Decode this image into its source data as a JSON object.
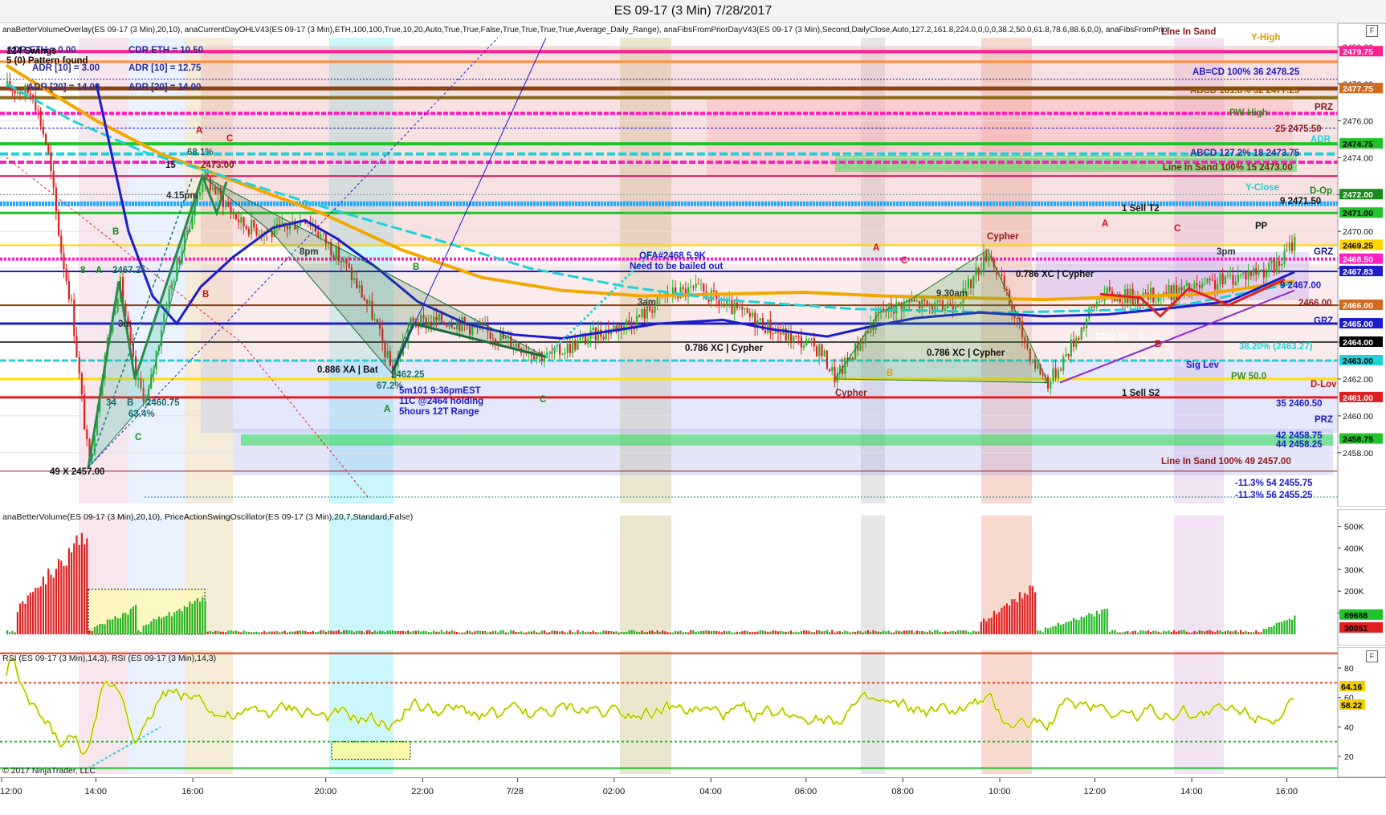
{
  "window_title": "ES 09-17 (3 Min)  7/28/2017",
  "copyright": "© 2017 NinjaTrader, LLC",
  "panel_format_icon": "F",
  "colors": {
    "up": "#26b526",
    "down": "#e02020",
    "swing": "#1c1ccc",
    "maline": "#f2a800",
    "cyan": "#1fd1d8",
    "magenta": "#ff1fbf",
    "rsi_line": "#9aa000",
    "rsi_fill": "#f0ff70"
  },
  "chart_data": [
    {
      "type": "line",
      "title": "ES 09-17 (3 Min)  7/28/2017",
      "indicator_text": "anaBetterVolumeOverlay(ES 09-17 (3 Min),20,10), anaCurrentDayOHLV43(ES 09-17 (3 Min),ETH,100,100,True,10,20,Auto,True,True,False,True,True,True,True,Average_Daily_Range), anaFibsFromPriorDayV43(ES 09-17 (3 Min),Second,DailyClose,Auto,127.2,161.8,224.0,0,0,0,38.2,50.0,61.8,78.6,88.6,0,0), anaFibsFromPrior",
      "ylim": [
        2455.25,
        2480.5
      ],
      "y_ticks": [
        2458.0,
        2460.0,
        2462.0,
        2464.0,
        2466.0,
        2468.0,
        2470.0,
        2472.0,
        2474.0,
        2476.0,
        2478.0,
        2480.0
      ],
      "y_tick_labels": [
        "2458.00",
        "2460.00",
        "2462.00",
        "2464.00",
        "2466.00",
        "2468.00",
        "2470.00",
        "2472.00",
        "2474.00",
        "2476.00",
        "2478.00",
        "2480.00"
      ],
      "price_badges": [
        {
          "value": 2479.75,
          "label": "2479.75",
          "color": "#ff1f8f"
        },
        {
          "value": 2477.75,
          "label": "2477.75",
          "color": "#d2691e"
        },
        {
          "value": 2474.75,
          "label": "2474.75",
          "color": "#22c22c"
        },
        {
          "value": 2472.0,
          "label": "2472.00",
          "color": "#1a8a1a"
        },
        {
          "value": 2471.0,
          "label": "2471.00",
          "color": "#22c22c"
        },
        {
          "value": 2469.25,
          "label": "2469.25",
          "color": "#ffd700"
        },
        {
          "value": 2468.5,
          "label": "2468.50",
          "color": "#ff1fbf"
        },
        {
          "value": 2467.83,
          "label": "2467.83",
          "color": "#1c1ccc"
        },
        {
          "value": 2466.0,
          "label": "2466.00",
          "color": "#d2691e"
        },
        {
          "value": 2465.0,
          "label": "2465.00",
          "color": "#1c1ccc"
        },
        {
          "value": 2464.0,
          "label": "2464.00",
          "color": "#000000"
        },
        {
          "value": 2463.0,
          "label": "2463.00",
          "color": "#1fd1d8"
        },
        {
          "value": 2461.0,
          "label": "2461.00",
          "color": "#e02020"
        },
        {
          "value": 2458.75,
          "label": "2458.75",
          "color": "#22c22c"
        }
      ],
      "overlay_text": [
        {
          "text": "ADR ETH = 0.00",
          "x": 8,
          "y": 66,
          "color": "#2b2b9a"
        },
        {
          "text": "CDR ETH = 10.50",
          "x": 160,
          "y": 66,
          "color": "#2b2b9a"
        },
        {
          "text": "ADR [10] = 3.00",
          "x": 40,
          "y": 88,
          "color": "#2b2b9a"
        },
        {
          "text": "ADR [10] = 12.75",
          "x": 160,
          "y": 88,
          "color": "#2b2b9a"
        },
        {
          "text": "ADR [20] = 14.00",
          "x": 34,
          "y": 112,
          "color": "#2b2b9a"
        },
        {
          "text": "ADR [20] = 14.00",
          "x": 160,
          "y": 112,
          "color": "#2b2b9a"
        },
        {
          "text": "124 Swings",
          "x": 8,
          "y": 67,
          "color": "#111111"
        },
        {
          "text": "5 (0) Pattern found",
          "x": 8,
          "y": 79,
          "color": "#111111"
        },
        {
          "text": "A",
          "x": 244,
          "y": 166,
          "color": "#d01010"
        },
        {
          "text": "C",
          "x": 282,
          "y": 176,
          "color": "#d01010"
        },
        {
          "text": "68.1%",
          "x": 233,
          "y": 193,
          "color": "#1a6a6a"
        },
        {
          "text": "15",
          "x": 206,
          "y": 209,
          "color": "#111111"
        },
        {
          "text": "2473.00",
          "x": 250,
          "y": 209,
          "color": "#8b1a1a"
        },
        {
          "text": "4.15pm",
          "x": 207,
          "y": 247,
          "color": "#333333"
        },
        {
          "text": "B",
          "x": 140,
          "y": 292,
          "color": "#1a8a1a"
        },
        {
          "text": "8",
          "x": 100,
          "y": 340,
          "color": "#1a8a1a"
        },
        {
          "text": "A",
          "x": 119,
          "y": 340,
          "color": "#1a8a1a"
        },
        {
          "text": "2467.25",
          "x": 140,
          "y": 340,
          "color": "#1a6a6a"
        },
        {
          "text": "B",
          "x": 252,
          "y": 370,
          "color": "#d01010"
        },
        {
          "text": "3m",
          "x": 147,
          "y": 407,
          "color": "#333333"
        },
        {
          "text": "34",
          "x": 132,
          "y": 505,
          "color": "#1a6a6a"
        },
        {
          "text": "B",
          "x": 158,
          "y": 505,
          "color": "#1a6a6a"
        },
        {
          "text": "2460.75",
          "x": 182,
          "y": 505,
          "color": "#1a6a6a"
        },
        {
          "text": "63.4%",
          "x": 160,
          "y": 519,
          "color": "#1a6a6a"
        },
        {
          "text": "C",
          "x": 168,
          "y": 548,
          "color": "#1a8a1a"
        },
        {
          "text": "49  X  2457.00",
          "x": 62,
          "y": 591,
          "color": "#111111"
        },
        {
          "text": "8pm",
          "x": 373,
          "y": 317,
          "color": "#333333"
        },
        {
          "text": "B",
          "x": 514,
          "y": 336,
          "color": "#1a8a1a"
        },
        {
          "text": "0.886 XA | Bat",
          "x": 395,
          "y": 464,
          "color": "#111111"
        },
        {
          "text": "2462.25",
          "x": 487,
          "y": 470,
          "color": "#1a6a6a"
        },
        {
          "text": "67.2%",
          "x": 469,
          "y": 484,
          "color": "#1a6a6a"
        },
        {
          "text": "5m101 9:36pmEST",
          "x": 497,
          "y": 490,
          "color": "#1c1ccc"
        },
        {
          "text": "11C @2464 holding",
          "x": 497,
          "y": 503,
          "color": "#1c1ccc"
        },
        {
          "text": "5hours 12T Range",
          "x": 497,
          "y": 516,
          "color": "#1c1ccc"
        },
        {
          "text": "A",
          "x": 478,
          "y": 513,
          "color": "#1a8a1a"
        },
        {
          "text": "C",
          "x": 672,
          "y": 501,
          "color": "#1a8a1a"
        },
        {
          "text": "OFA#2468 5.9K",
          "x": 796,
          "y": 322,
          "color": "#1c1ccc"
        },
        {
          "text": "Need to be bailed out",
          "x": 784,
          "y": 335,
          "color": "#1c1ccc"
        },
        {
          "text": "3am",
          "x": 794,
          "y": 380,
          "color": "#333333"
        },
        {
          "text": "0.786 XC | Cypher",
          "x": 853,
          "y": 437,
          "color": "#111111"
        },
        {
          "text": "A",
          "x": 1087,
          "y": 312,
          "color": "#d01010"
        },
        {
          "text": "C",
          "x": 1122,
          "y": 328,
          "color": "#d01010"
        },
        {
          "text": "B",
          "x": 1104,
          "y": 468,
          "color": "#d8a000"
        },
        {
          "text": "Cypher",
          "x": 1040,
          "y": 493,
          "color": "#8b1a1a"
        },
        {
          "text": "9.30am",
          "x": 1166,
          "y": 369,
          "color": "#333333"
        },
        {
          "text": "0.786 XC | Cypher",
          "x": 1154,
          "y": 443,
          "color": "#111111"
        },
        {
          "text": "Cypher",
          "x": 1229,
          "y": 298,
          "color": "#8b1a1a"
        },
        {
          "text": "0.786 XC | Cypher",
          "x": 1265,
          "y": 345,
          "color": "#111111"
        },
        {
          "text": "A",
          "x": 1372,
          "y": 282,
          "color": "#d01010"
        },
        {
          "text": "C",
          "x": 1462,
          "y": 288,
          "color": "#d01010"
        },
        {
          "text": "B",
          "x": 1438,
          "y": 432,
          "color": "#d01010"
        },
        {
          "text": "$262.50",
          "x": 1364,
          "y": 423,
          "color": "#ffffff"
        },
        {
          "text": "1 - 1L",
          "x": 1418,
          "y": 423,
          "color": "#ffffff"
        },
        {
          "text": "3pm",
          "x": 1515,
          "y": 317,
          "color": "#333333"
        },
        {
          "text": "PP",
          "x": 1563,
          "y": 285,
          "color": "#111111"
        },
        {
          "text": "1  Sell T2",
          "x": 1397,
          "y": 263,
          "color": "#111111"
        },
        {
          "text": "1  Sell S2",
          "x": 1397,
          "y": 493,
          "color": "#111111"
        },
        {
          "text": "Line In Sand",
          "x": 1446,
          "y": 43,
          "color": "#8b1a1a"
        },
        {
          "text": "Y-High",
          "x": 1558,
          "y": 50,
          "color": "#d8a000"
        },
        {
          "text": "AB=CD   100%   36   2478.25",
          "x": 1485,
          "y": 93,
          "color": "#1c1ccc"
        },
        {
          "text": "ABCD   161.8%   32   2477.25",
          "x": 1482,
          "y": 116,
          "color": "#8b5a00"
        },
        {
          "text": "PRZ",
          "x": 1637,
          "y": 137,
          "color": "#8b1a1a"
        },
        {
          "text": "PW-High",
          "x": 1531,
          "y": 144,
          "color": "#3a8a1a"
        },
        {
          "text": "25   2475.50",
          "x": 1588,
          "y": 164,
          "color": "#8b1a1a"
        },
        {
          "text": "ADR",
          "x": 1632,
          "y": 177,
          "color": "#1fd1d8"
        },
        {
          "text": "ABCD   127.2%   18   2473.75",
          "x": 1482,
          "y": 194,
          "color": "#2b2b9a"
        },
        {
          "text": "Line In Sand   100%   15   2473.00",
          "x": 1448,
          "y": 212,
          "color": "#8b1a1a"
        },
        {
          "text": "Y-Close",
          "x": 1551,
          "y": 237,
          "color": "#1fd1d8"
        },
        {
          "text": "D-Op",
          "x": 1631,
          "y": 241,
          "color": "#1a8a1a"
        },
        {
          "text": "9   2471.50",
          "x": 1594,
          "y": 254,
          "color": "#111111"
        },
        {
          "text": "GRZ",
          "x": 1636,
          "y": 317,
          "color": "#1a1a8a"
        },
        {
          "text": "9   2467.00",
          "x": 1594,
          "y": 359,
          "color": "#1c1ccc"
        },
        {
          "text": "2466.00",
          "x": 1617,
          "y": 381,
          "color": "#8b1a1a"
        },
        {
          "text": "GRZ",
          "x": 1636,
          "y": 403,
          "color": "#1c1ccc"
        },
        {
          "text": "38.20% (2463.27)",
          "x": 1543,
          "y": 435,
          "color": "#1fd1d8"
        },
        {
          "text": "Sig Lev",
          "x": 1477,
          "y": 458,
          "color": "#1c1ccc"
        },
        {
          "text": "PW 50.0",
          "x": 1533,
          "y": 472,
          "color": "#3a8a1a"
        },
        {
          "text": "D-Lov",
          "x": 1632,
          "y": 482,
          "color": "#d01010"
        },
        {
          "text": "35   2460.50",
          "x": 1589,
          "y": 506,
          "color": "#1c1ccc"
        },
        {
          "text": "PRZ",
          "x": 1637,
          "y": 526,
          "color": "#1c1ccc"
        },
        {
          "text": "42   2458.75",
          "x": 1589,
          "y": 546,
          "color": "#1c1ccc"
        },
        {
          "text": "44   2458.25",
          "x": 1589,
          "y": 557,
          "color": "#1c1ccc"
        },
        {
          "text": "Line In Sand   100%   49   2457.00",
          "x": 1446,
          "y": 578,
          "color": "#8b1a1a"
        },
        {
          "text": "-11.3%   54   2455.75",
          "x": 1538,
          "y": 605,
          "color": "#1c1ccc"
        },
        {
          "text": "-11.3%   56   2455.25",
          "x": 1538,
          "y": 620,
          "color": "#1c1ccc"
        }
      ]
    },
    {
      "type": "bar",
      "title": "anaBetterVolume(ES 09-17 (3 Min),20,10), PriceActionSwingOscillator(ES 09-17 (3 Min),20,7,Standard,False)",
      "ylim": [
        0,
        550000
      ],
      "y_ticks": [
        100000,
        200000,
        300000,
        400000,
        500000
      ],
      "y_tick_labels": [
        "100K",
        "200K",
        "300K",
        "400K",
        "500K"
      ],
      "last_values": [
        {
          "value": 89688,
          "label": "89688",
          "color": "#22c22c"
        },
        {
          "value": 30051,
          "label": "30051",
          "color": "#e02020"
        }
      ]
    },
    {
      "type": "line",
      "title": "RSI (ES 09-17 (3 Min),14,3), RSI (ES 09-17 (3 Min),14,3)",
      "ylim": [
        8,
        92
      ],
      "y_ticks": [
        20,
        40,
        60,
        80
      ],
      "y_tick_labels": [
        "20",
        "40",
        "60",
        "80"
      ],
      "levels": [
        70,
        30
      ],
      "last_values": [
        {
          "value": 64.16,
          "label": "64.16",
          "color": "#f2d000"
        },
        {
          "value": 58.22,
          "label": "58.22",
          "color": "#f2d000"
        }
      ]
    }
  ],
  "x_axis": {
    "ticks": [
      {
        "label": "12:00",
        "pos": 0.0
      },
      {
        "label": "14:00",
        "pos": 0.0705
      },
      {
        "label": "16:00",
        "pos": 0.1429
      },
      {
        "label": "20:00",
        "pos": 0.2423
      },
      {
        "label": "22:00",
        "pos": 0.3147
      },
      {
        "label": "7/28",
        "pos": 0.3857
      },
      {
        "label": "02:00",
        "pos": 0.4578
      },
      {
        "label": "04:00",
        "pos": 0.5302
      },
      {
        "label": "06:00",
        "pos": 0.6013
      },
      {
        "label": "08:00",
        "pos": 0.6737
      },
      {
        "label": "10:00",
        "pos": 0.7461
      },
      {
        "label": "12:00",
        "pos": 0.8172
      },
      {
        "label": "14:00",
        "pos": 0.8896
      },
      {
        "label": "16:00",
        "pos": 0.9607
      }
    ]
  }
}
